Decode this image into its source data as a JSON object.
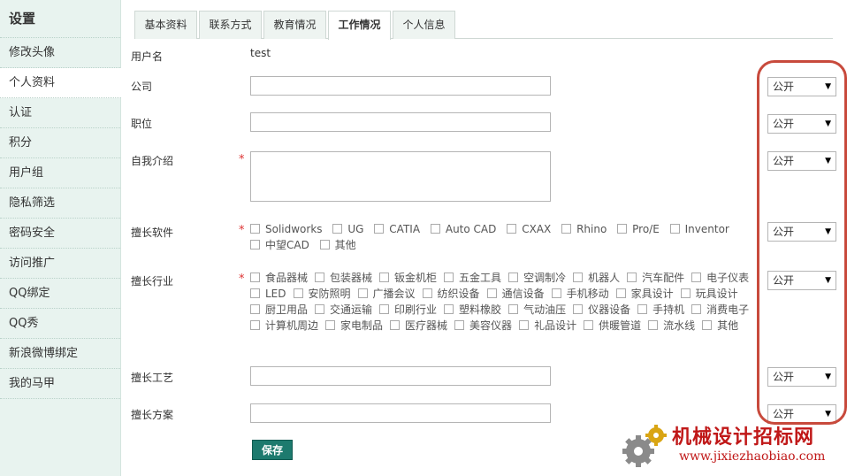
{
  "sidebar": {
    "title": "设置",
    "items": [
      {
        "label": "修改头像"
      },
      {
        "label": "个人资料"
      },
      {
        "label": "认证"
      },
      {
        "label": "积分"
      },
      {
        "label": "用户组"
      },
      {
        "label": "隐私筛选"
      },
      {
        "label": "密码安全"
      },
      {
        "label": "访问推广"
      },
      {
        "label": "QQ绑定"
      },
      {
        "label": "QQ秀"
      },
      {
        "label": "新浪微博绑定"
      },
      {
        "label": "我的马甲"
      }
    ]
  },
  "tabs": [
    {
      "label": "基本资料"
    },
    {
      "label": "联系方式"
    },
    {
      "label": "教育情况"
    },
    {
      "label": "工作情况"
    },
    {
      "label": "个人信息"
    }
  ],
  "form": {
    "username": {
      "label": "用户名",
      "value": "test"
    },
    "company": {
      "label": "公司",
      "value": ""
    },
    "position": {
      "label": "职位",
      "value": ""
    },
    "intro": {
      "label": "自我介绍",
      "value": ""
    },
    "software": {
      "label": "擅长软件",
      "options": [
        "Solidworks",
        "UG",
        "CATIA",
        "Auto CAD",
        "CXAX",
        "Rhino",
        "Pro/E",
        "Inventor",
        "中望CAD",
        "其他"
      ]
    },
    "industry": {
      "label": "擅长行业",
      "options": [
        "食品器械",
        "包装器械",
        "钣金机柜",
        "五金工具",
        "空调制冷",
        "机器人",
        "汽车配件",
        "电子仪表",
        "LED",
        "安防照明",
        "广播会议",
        "纺织设备",
        "通信设备",
        "手机移动",
        "家具设计",
        "玩具设计",
        "厨卫用品",
        "交通运输",
        "印刷行业",
        "塑料橡胶",
        "气动油压",
        "仪器设备",
        "手持机",
        "消费电子",
        "计算机周边",
        "家电制品",
        "医疗器械",
        "美容仪器",
        "礼品设计",
        "供暖管道",
        "流水线",
        "其他"
      ]
    },
    "craft": {
      "label": "擅长工艺",
      "value": ""
    },
    "plan": {
      "label": "擅长方案",
      "value": ""
    },
    "privacy": {
      "company": "公开",
      "position": "公开",
      "intro": "公开",
      "software": "公开",
      "industry": "公开",
      "craft": "公开",
      "plan": "公开"
    },
    "save_label": "保存"
  },
  "watermark": {
    "title": "机械设计招标网",
    "url": "www.jixiezhaobiao.com"
  },
  "colors": {
    "accent": "#1d7a6e",
    "sidebar_bg": "#e8f3ef",
    "required": "#dd3333",
    "highlight": "#c84a3c",
    "watermark": "#c01818"
  }
}
